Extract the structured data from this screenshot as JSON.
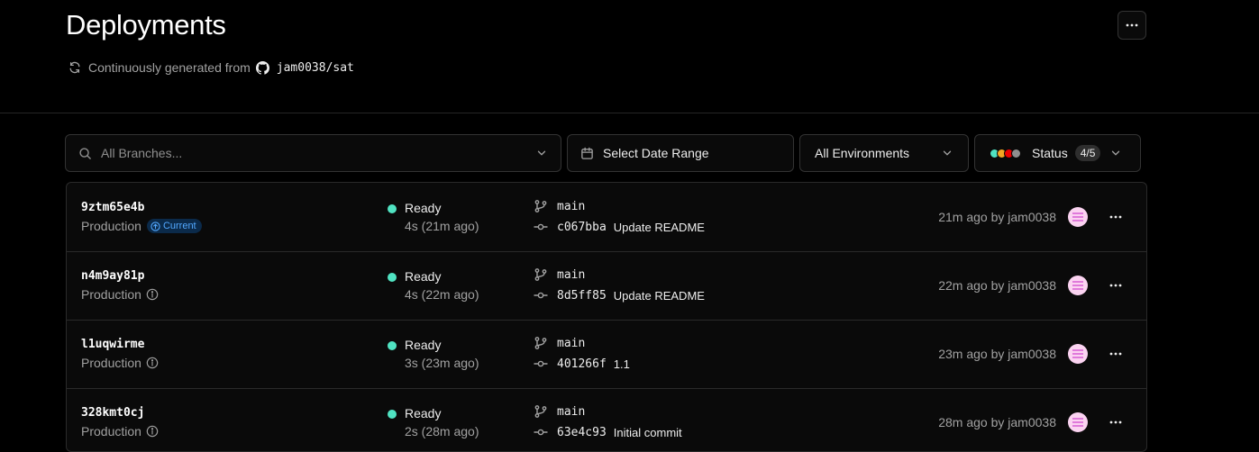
{
  "header": {
    "title": "Deployments",
    "subtitle_prefix": "Continuously generated from",
    "repo": "jam0038/sat",
    "more_icon": "ellipsis-icon"
  },
  "filters": {
    "branch_placeholder": "All Branches...",
    "date_label": "Select Date Range",
    "env_label": "All Environments",
    "status_label": "Status",
    "status_count": "4/5",
    "status_colors": [
      "#50e3c2",
      "#f5a623",
      "#e00",
      "#8f8f8f"
    ]
  },
  "deployments": [
    {
      "id": "9ztm65e4b",
      "environment": "Production",
      "current_label": "Current",
      "status": "Ready",
      "duration": "4s (21m ago)",
      "branch": "main",
      "commit_hash": "c067bba",
      "commit_message": "Update README",
      "time_by": "21m ago by jam0038"
    },
    {
      "id": "n4m9ay81p",
      "environment": "Production",
      "status": "Ready",
      "duration": "4s (22m ago)",
      "branch": "main",
      "commit_hash": "8d5ff85",
      "commit_message": "Update README",
      "time_by": "22m ago by jam0038"
    },
    {
      "id": "l1uqwirme",
      "environment": "Production",
      "status": "Ready",
      "duration": "3s (23m ago)",
      "branch": "main",
      "commit_hash": "401266f",
      "commit_message": "1.1",
      "time_by": "23m ago by jam0038"
    },
    {
      "id": "328kmt0cj",
      "environment": "Production",
      "status": "Ready",
      "duration": "2s (28m ago)",
      "branch": "main",
      "commit_hash": "63e4c93",
      "commit_message": "Initial commit",
      "time_by": "28m ago by jam0038"
    }
  ],
  "colors": {
    "ready": "#50e3c2",
    "current_badge_bg": "#0b2a4a",
    "current_badge_text": "#52a8ff"
  }
}
